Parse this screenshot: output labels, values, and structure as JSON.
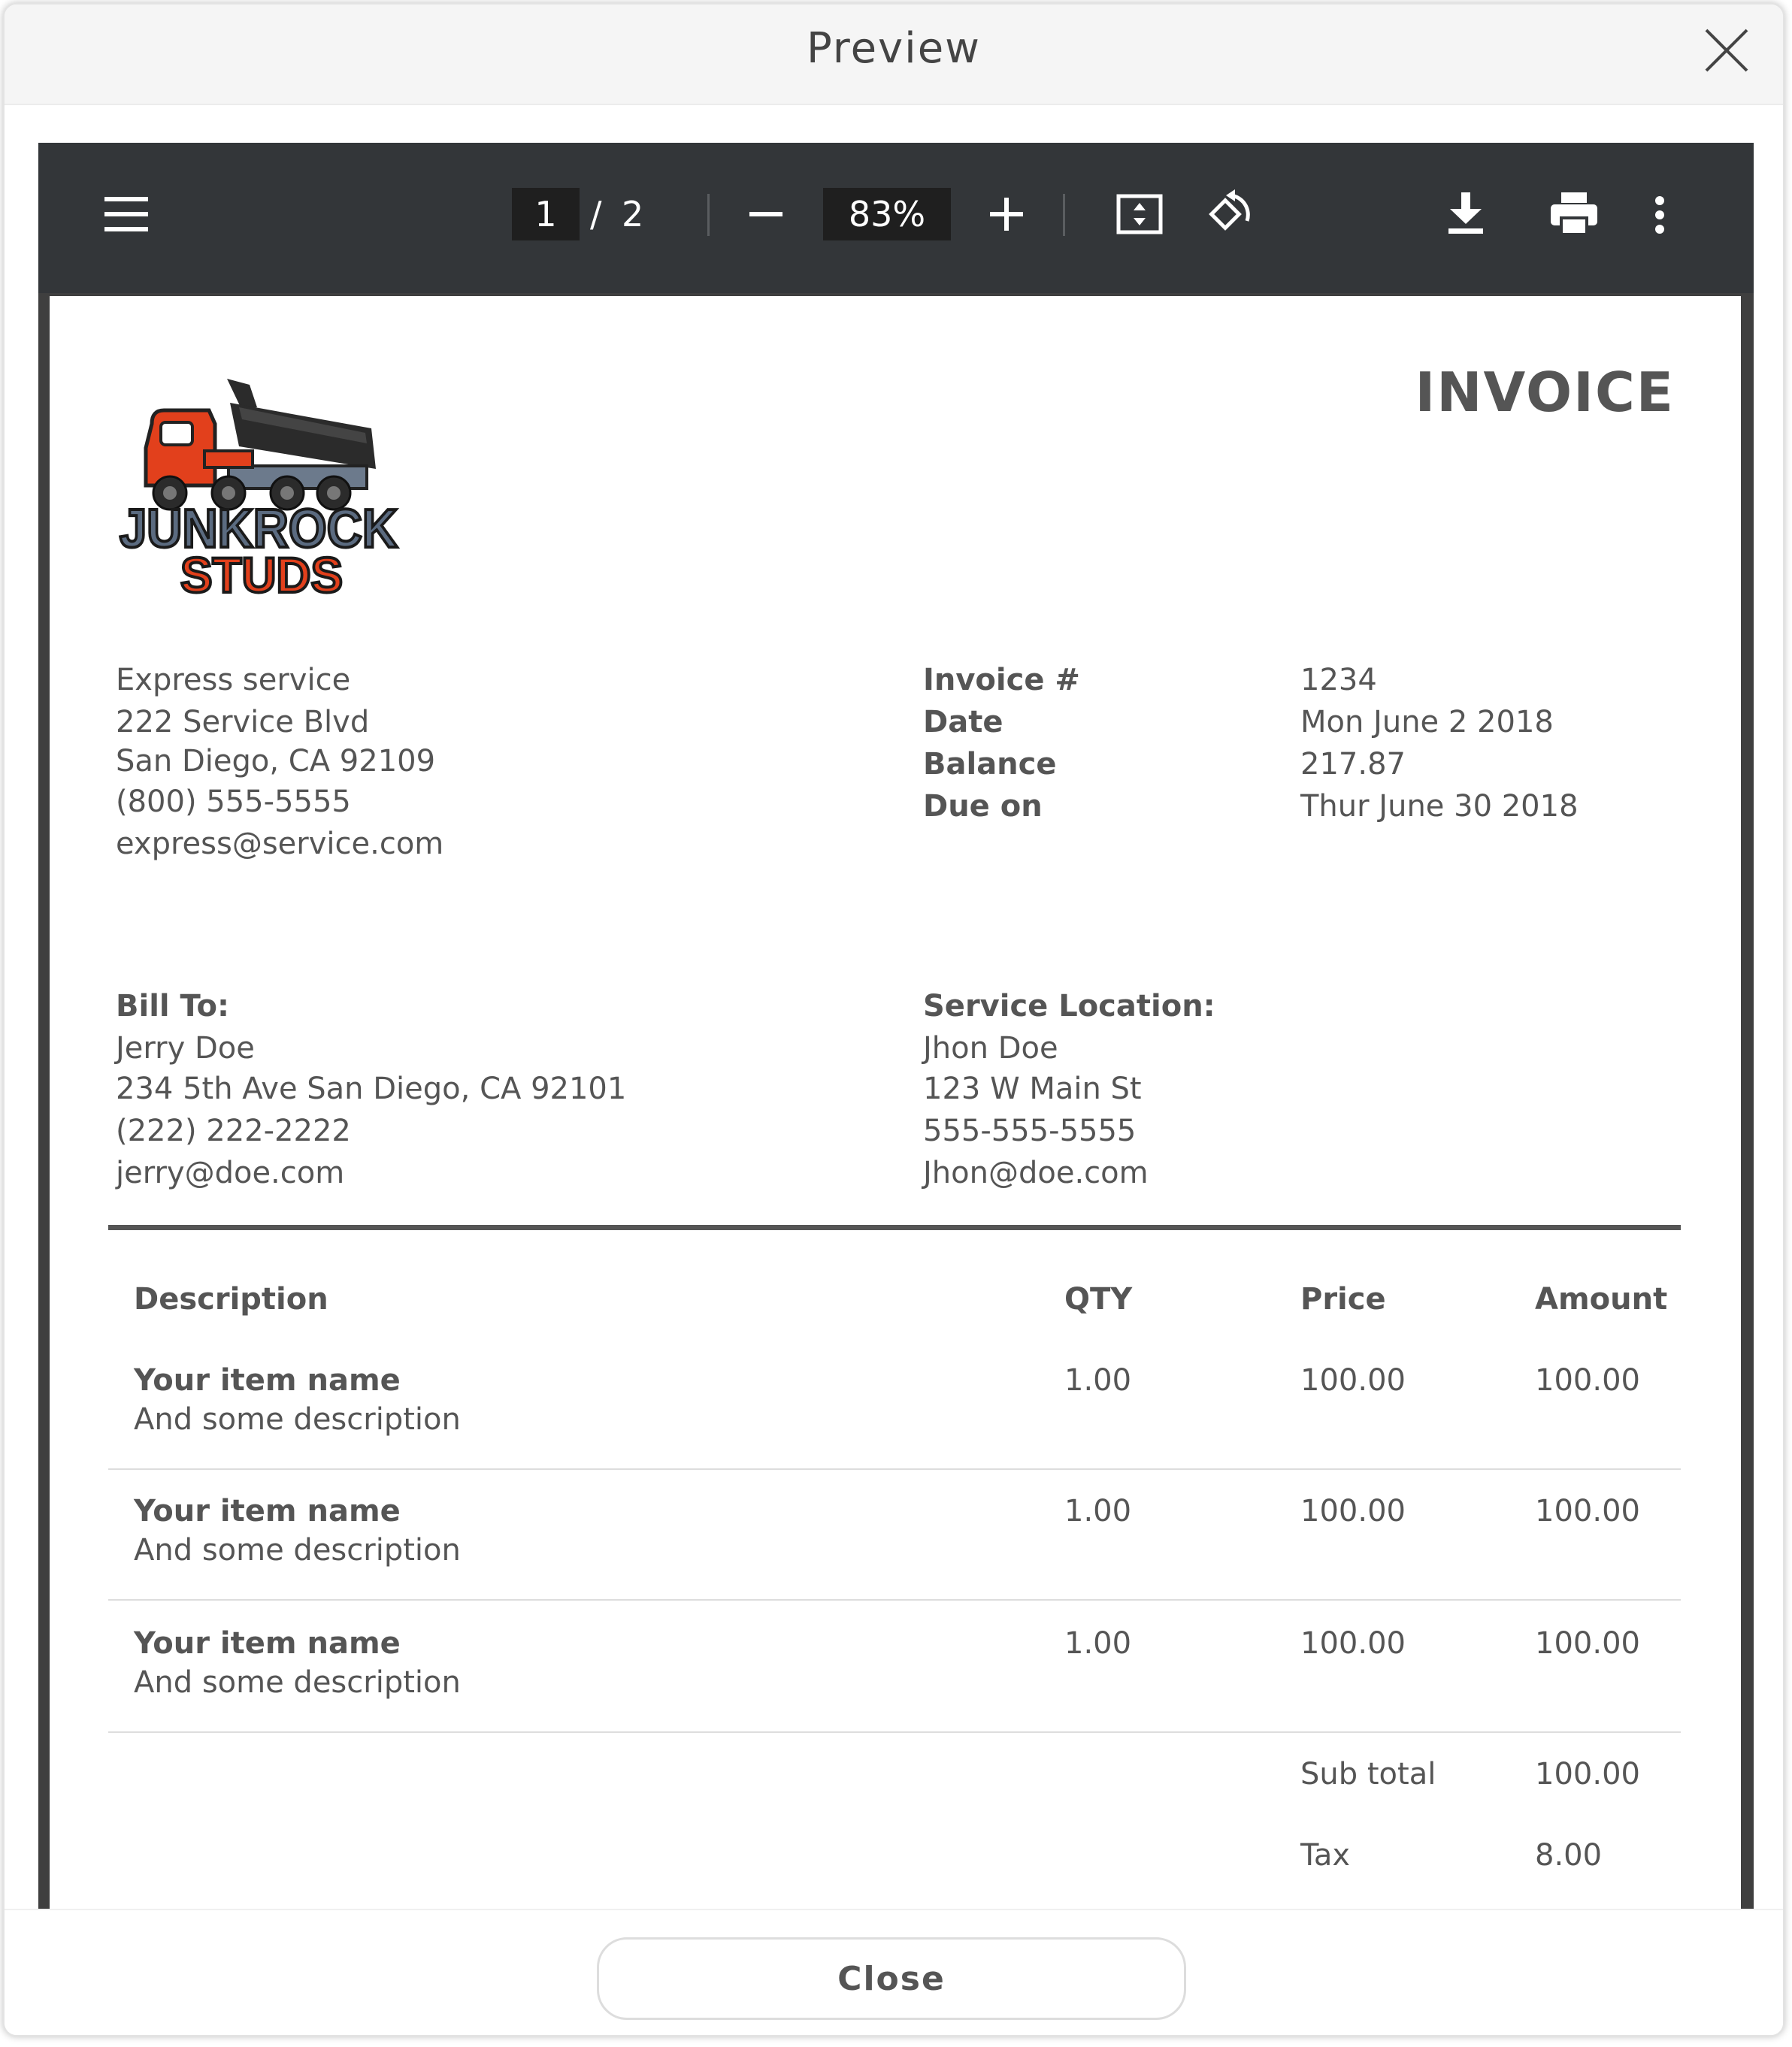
{
  "modal": {
    "title": "Preview",
    "close_button": "Close"
  },
  "toolbar": {
    "current_page": "1",
    "page_separator": "/",
    "total_pages": "2",
    "zoom": "83%"
  },
  "invoice": {
    "title": "INVOICE",
    "logo_text_top": "JUNKROCK",
    "logo_text_bottom": "STUDS",
    "company": {
      "name": "Express service",
      "street": "222 Service Blvd",
      "city": "San Diego, CA 92109",
      "phone": "(800) 555-5555",
      "email": "express@service.com"
    },
    "meta": [
      {
        "label": "Invoice #",
        "value": "1234"
      },
      {
        "label": "Date",
        "value": "Mon June 2 2018"
      },
      {
        "label": "Balance",
        "value": "217.87"
      },
      {
        "label": "Due on",
        "value": "Thur June 30 2018"
      }
    ],
    "bill_to": {
      "heading": "Bill To:",
      "name": "Jerry Doe",
      "address": "234 5th Ave San Diego, CA 92101",
      "phone": "(222) 222-2222",
      "email": "jerry@doe.com"
    },
    "service_location": {
      "heading": "Service Location:",
      "name": "Jhon Doe",
      "address": "123 W Main St",
      "phone": "555-555-5555",
      "email": "Jhon@doe.com"
    },
    "table": {
      "headers": {
        "description": "Description",
        "qty": "QTY",
        "price": "Price",
        "amount": "Amount"
      },
      "rows": [
        {
          "name": "Your item name",
          "desc": "And some description",
          "qty": "1.00",
          "price": "100.00",
          "amount": "100.00"
        },
        {
          "name": "Your item name",
          "desc": "And some description",
          "qty": "1.00",
          "price": "100.00",
          "amount": "100.00"
        },
        {
          "name": "Your item name",
          "desc": "And some description",
          "qty": "1.00",
          "price": "100.00",
          "amount": "100.00"
        }
      ]
    },
    "totals": [
      {
        "label": "Sub total",
        "value": "100.00"
      },
      {
        "label": "Tax",
        "value": "8.00"
      }
    ]
  },
  "colors": {
    "toolbar_bg": "#333639",
    "text": "#555555",
    "logo_red": "#e2401c",
    "logo_slate": "#5b6b80"
  }
}
